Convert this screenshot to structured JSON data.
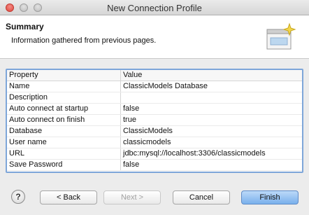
{
  "window": {
    "title": "New Connection Profile"
  },
  "header": {
    "title": "Summary",
    "description": "Information gathered from previous pages."
  },
  "table": {
    "columns": [
      "Property",
      "Value"
    ],
    "rows": [
      {
        "property": "Name",
        "value": "ClassicModels Database"
      },
      {
        "property": "Description",
        "value": ""
      },
      {
        "property": "Auto connect at startup",
        "value": "false"
      },
      {
        "property": "Auto connect on finish",
        "value": "true"
      },
      {
        "property": "Database",
        "value": "ClassicModels"
      },
      {
        "property": "User name",
        "value": "classicmodels"
      },
      {
        "property": "URL",
        "value": "jdbc:mysql://localhost:3306/classicmodels"
      },
      {
        "property": "Save Password",
        "value": "false"
      }
    ]
  },
  "buttons": {
    "help": "?",
    "back": "< Back",
    "next": "Next >",
    "cancel": "Cancel",
    "finish": "Finish"
  },
  "colors": {
    "finish_button": "#79b0ec",
    "table_border": "#7ea6d9"
  }
}
